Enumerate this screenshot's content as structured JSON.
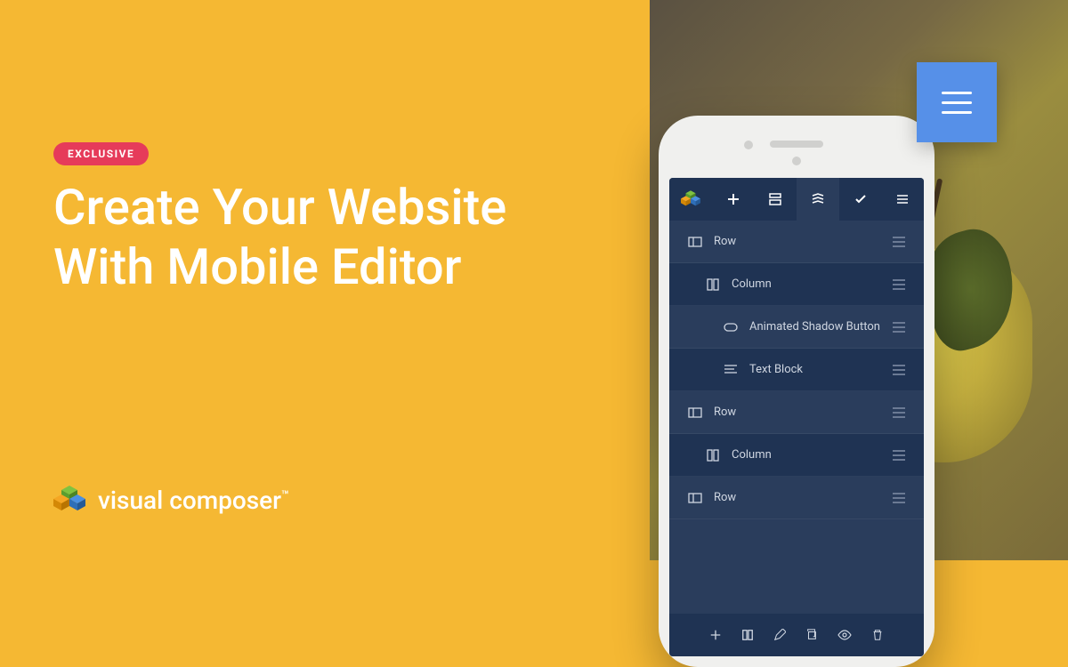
{
  "badge": "EXCLUSIVE",
  "headline_line1": "Create Your Website",
  "headline_line2": "With Mobile Editor",
  "brand": "visual composer",
  "brand_tm": "™",
  "tree": [
    {
      "label": "Row",
      "indent": 0,
      "icon": "row",
      "alt": false
    },
    {
      "label": "Column",
      "indent": 1,
      "icon": "column",
      "alt": true
    },
    {
      "label": "Animated Shadow Button",
      "indent": 2,
      "icon": "button",
      "alt": false
    },
    {
      "label": "Text Block",
      "indent": 2,
      "icon": "text",
      "alt": true
    },
    {
      "label": "Row",
      "indent": 0,
      "icon": "row",
      "alt": false
    },
    {
      "label": "Column",
      "indent": 1,
      "icon": "column",
      "alt": true
    },
    {
      "label": "Row",
      "indent": 0,
      "icon": "row",
      "alt": false
    }
  ],
  "colors": {
    "bg": "#f5b833",
    "panel_dark": "#1f3353",
    "panel": "#2a3d5c",
    "accent": "#5690e8",
    "badge": "#e63b5a"
  }
}
